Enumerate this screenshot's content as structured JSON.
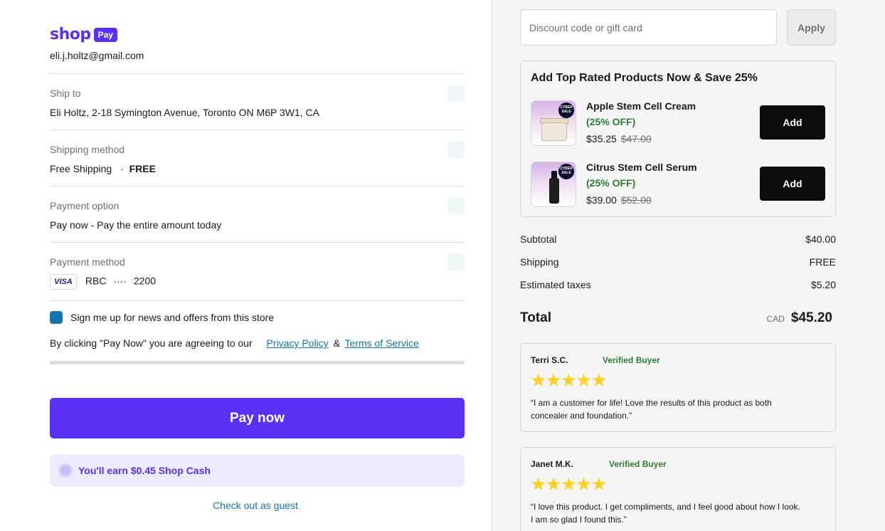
{
  "brand": {
    "logo_text": "shop",
    "logo_badge": "Pay",
    "color": "#5a31f4"
  },
  "account": {
    "email": "eli.j.holtz@gmail.com"
  },
  "ship_to": {
    "label": "Ship to",
    "value": "Eli Holtz, 2-18 Symington Avenue, Toronto ON M6P 3W1, CA"
  },
  "shipping_method": {
    "label": "Shipping method",
    "name": "Free Shipping",
    "separator": "·",
    "price": "FREE"
  },
  "payment_option": {
    "label": "Payment option",
    "value": "Pay now - Pay the entire amount today"
  },
  "payment_method": {
    "label": "Payment method",
    "card_brand": "VISA",
    "bank": "RBC",
    "dots": "····",
    "last4": "2200"
  },
  "signup": {
    "label": "Sign me up for news and offers from this store",
    "checked": true
  },
  "consent": {
    "prefix": "By clicking \"Pay Now\" you are agreeing to our",
    "privacy": "Privacy Policy",
    "amp": "&",
    "terms": "Terms of Service"
  },
  "pay_button": "Pay now",
  "shop_cash": "You'll earn $0.45 Shop Cash",
  "guest_link": "Check out as guest",
  "discount": {
    "placeholder": "Discount code or gift card",
    "apply": "Apply"
  },
  "upsell": {
    "title": "Add Top Rated Products Now & Save 25%",
    "badge_text": "CYBER SALE",
    "products": [
      {
        "name": "Apple Stem Cell Cream",
        "discount": "(25% OFF)",
        "price": "$35.25",
        "old_price": "$47.00",
        "button": "Add"
      },
      {
        "name": "Citrus Stem Cell Serum",
        "discount": "(25% OFF)",
        "price": "$39.00",
        "old_price": "$52.00",
        "button": "Add"
      }
    ]
  },
  "summary": {
    "subtotal_label": "Subtotal",
    "subtotal": "$40.00",
    "shipping_label": "Shipping",
    "shipping": "FREE",
    "taxes_label": "Estimated taxes",
    "taxes": "$5.20",
    "total_label": "Total",
    "currency": "CAD",
    "total": "$45.20"
  },
  "reviews": [
    {
      "name": "Terri S.C.",
      "verified": "Verified Buyer",
      "stars": "★★★★★",
      "rating": 5,
      "text": "“I am a customer for life! Love the results of this product as both concealer and foundation.”"
    },
    {
      "name": "Janet M.K.",
      "verified": "Verified Buyer",
      "stars": "★★★★★",
      "rating": 5,
      "text": "“I love this product. I get compliments, and I feel good about how I look. I am so glad I found this.”"
    }
  ]
}
